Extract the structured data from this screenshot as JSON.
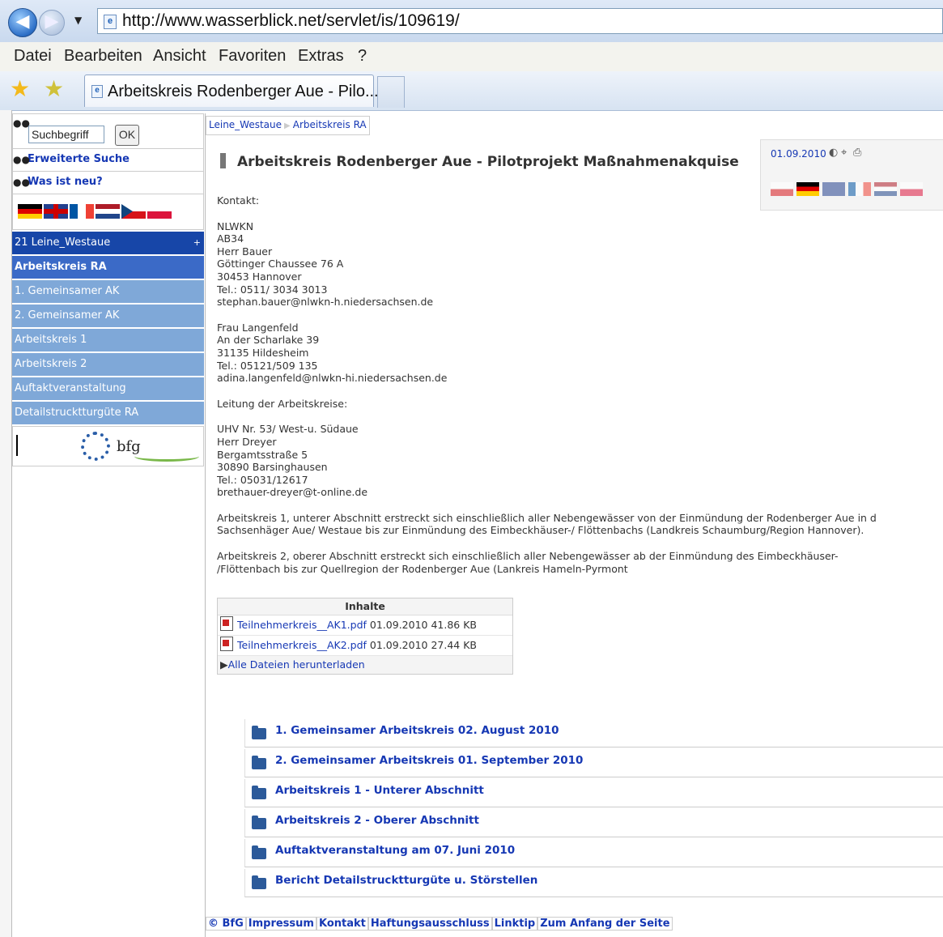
{
  "browser": {
    "url": "http://www.wasserblick.net/servlet/is/109619/",
    "menu": [
      "Datei",
      "Bearbeiten",
      "Ansicht",
      "Favoriten",
      "Extras",
      "?"
    ],
    "tab_title": "Arbeitskreis Rodenberger Aue - Pilo..."
  },
  "sidebar": {
    "search_placeholder": "Suchbegriff",
    "search_button": "OK",
    "advanced_search": "Erweiterte Suche",
    "whats_new": "Was ist neu?",
    "nav_top": "21 Leine_Westaue",
    "nav_top_plus": "+",
    "nav_items": [
      "Arbeitskreis RA",
      "1. Gemeinsamer AK",
      "2. Gemeinsamer AK",
      "Arbeitskreis 1",
      "Arbeitskreis 2",
      "Auftaktveranstaltung",
      "Detailstrucktturgüte RA"
    ]
  },
  "breadcrumb": [
    "Leine_Westaue",
    "Arbeitskreis RA"
  ],
  "page": {
    "title": "Arbeitskreis Rodenberger Aue - Pilotprojekt Maßnahmenakquise",
    "date": "01.09.2010",
    "contact_label": "Kontakt:",
    "contact1": [
      "NLWKN",
      "AB34",
      "Herr Bauer",
      "Göttinger Chaussee 76 A",
      "30453 Hannover",
      "Tel.: 0511/ 3034 3013",
      "stephan.bauer@nlwkn-h.niedersachsen.de"
    ],
    "contact2": [
      "Frau Langenfeld",
      "An der Scharlake 39",
      "31135 Hildesheim",
      "Tel.: 05121/509 135",
      "adina.langenfeld@nlwkn-hi.niedersachsen.de"
    ],
    "lead_label": "Leitung der Arbeitskreise:",
    "contact3": [
      "UHV Nr. 53/ West-u. Südaue",
      "Herr Dreyer",
      "Bergamtsstraße 5",
      "30890 Barsinghausen",
      "Tel.: 05031/12617",
      "brethauer-dreyer@t-online.de"
    ],
    "para1": [
      "Arbeitskreis 1, unterer Abschnitt erstreckt sich einschließlich aller Nebengewässer von der Einmündung der Rodenberger Aue in d",
      "Sachsenhäger Aue/ Westaue bis zur Einmündung des Eimbeckhäuser-/ Flöttenbachs (Landkreis Schaumburg/Region Hannover)."
    ],
    "para2": [
      "Arbeitskreis 2, oberer Abschnitt erstreckt sich einschließlich aller Nebengewässer ab der Einmündung des Eimbeckhäuser-",
      "/Flöttenbach bis zur Quellregion der Rodenberger Aue (Lankreis Hameln-Pyrmont"
    ]
  },
  "files": {
    "header": "Inhalte",
    "rows": [
      {
        "name": "Teilnehmerkreis__AK1.pdf",
        "date": "01.09.2010",
        "size": "41.86 KB"
      },
      {
        "name": "Teilnehmerkreis__AK2.pdf",
        "date": "01.09.2010",
        "size": "27.44 KB"
      }
    ],
    "download_all": "Alle Dateien herunterladen"
  },
  "folders": [
    "1. Gemeinsamer Arbeitskreis 02. August 2010",
    "2. Gemeinsamer Arbeitskreis 01. September 2010",
    "Arbeitskreis 1 - Unterer Abschnitt",
    "Arbeitskreis 2 - Oberer Abschnitt",
    "Auftaktveranstaltung am 07. Juni 2010",
    "Bericht Detailstrucktturgüte u. Störstellen"
  ],
  "footer": [
    "© BfG",
    "Impressum",
    "Kontakt",
    "Haftungsausschluss",
    "Linktip",
    "Zum Anfang der Seite"
  ],
  "colors": {
    "link": "#1638b4",
    "nav_dark": "#1746a8",
    "nav_light": "#7fa8d8"
  }
}
